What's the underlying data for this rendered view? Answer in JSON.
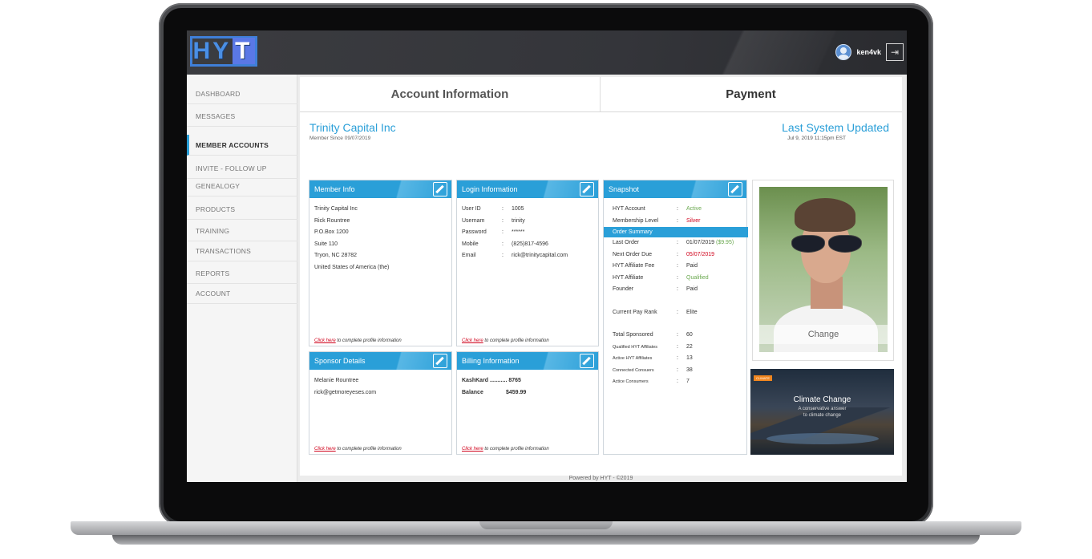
{
  "app": {
    "logo_text": "HY",
    "logo_text_t": "T",
    "username": "ken4vk",
    "footer": "Powered by HYT - ©2019"
  },
  "sidebar": {
    "items": [
      {
        "label": "DASHBOARD",
        "active": false
      },
      {
        "label": "MESSAGES",
        "active": false
      },
      {
        "label": "MEMBER ACCOUNTS",
        "active": true
      },
      {
        "label": "INVITE - FOLLOW UP",
        "active": false
      },
      {
        "label": "GENEALOGY",
        "active": false
      },
      {
        "label": "PRODUCTS",
        "active": false
      },
      {
        "label": "TRAINING",
        "active": false
      },
      {
        "label": "TRANSACTIONS",
        "active": false
      },
      {
        "label": "REPORTS",
        "active": false
      },
      {
        "label": "ACCOUNT",
        "active": false
      }
    ]
  },
  "tabs": [
    {
      "label": "Account Information"
    },
    {
      "label": "Payment"
    }
  ],
  "header": {
    "company": "Trinity Capital Inc",
    "member_since": "Member Since 09/07/2019",
    "last_updated_title": "Last System Updated",
    "last_updated_date": "Jul 9, 2019 11:15pm EST"
  },
  "member_info": {
    "title": "Member Info",
    "lines": [
      "Trinity Capital Inc",
      "Rick Rountree",
      "P.O.Box 1200",
      "Suite 110",
      "Tryon, NC 28782",
      "United States of America (the)"
    ],
    "footer_link": "Click here",
    "footer_text": " to complete profile information"
  },
  "login_info": {
    "title": "Login Information",
    "rows": [
      {
        "k": "User ID",
        "v": "1005"
      },
      {
        "k": "Usernam",
        "v": "trinity"
      },
      {
        "k": "Password",
        "v": "******"
      },
      {
        "k": "Mobile",
        "v": "(825)817-4596"
      },
      {
        "k": "Email",
        "v": "rick@trinitycapital.com"
      }
    ],
    "footer_link": "Click here",
    "footer_text": " to complete profile information"
  },
  "snapshot": {
    "title": "Snapshot",
    "hyt_account_label": "HYT Account",
    "hyt_account_value": "Active",
    "membership_label": "Membership Level",
    "membership_value": "Silver",
    "order_summary": "Order Summary",
    "last_order_label": "Last Order",
    "last_order_value": "01/07/2019",
    "last_order_amount": "($9.95)",
    "next_order_label": "Next Order Due",
    "next_order_value": "05/07/2019",
    "affiliate_fee_label": "HYT Affiliate Fee",
    "affiliate_fee_value": "Paid",
    "affiliate_label": "HYT Affiliate",
    "affiliate_value": "Qualified",
    "founder_label": "Founder",
    "founder_value": "Paid",
    "pay_rank_label": "Current Pay Rank",
    "pay_rank_value": "Elite",
    "total_sponsored_label": "Total Sponsored",
    "total_sponsored_value": "60",
    "qualified_affiliates_label": "Qualified HYT Affiliates",
    "qualified_affiliates_value": "22",
    "active_affiliates_label": "Active HYT Affiliates",
    "active_affiliates_value": "13",
    "connected_label": "Connected Consuers",
    "connected_value": "38",
    "active_consumers_label": "Actice Consumers",
    "active_consumers_value": "7"
  },
  "sponsor": {
    "title": "Sponsor Details",
    "lines": [
      "Melanie Rountree",
      "rick@getmoreyeses.com"
    ],
    "footer_link": "Click here",
    "footer_text": " to complete profile information"
  },
  "billing": {
    "title": "Billing Information",
    "card_line": "KashKard ........... 8765",
    "balance_label": "Balance",
    "balance_value": "$459.99",
    "footer_link": "Click here",
    "footer_text": " to complete profile information"
  },
  "photo": {
    "change_label": "Change"
  },
  "promo": {
    "badge": "CLIMATE",
    "title": "Climate Change",
    "subtitle_1": "A conservative answer",
    "subtitle_2": "to climate change"
  },
  "colors": {
    "accent": "#2a9fd8",
    "green": "#6aa84f",
    "red": "#d0021b"
  }
}
